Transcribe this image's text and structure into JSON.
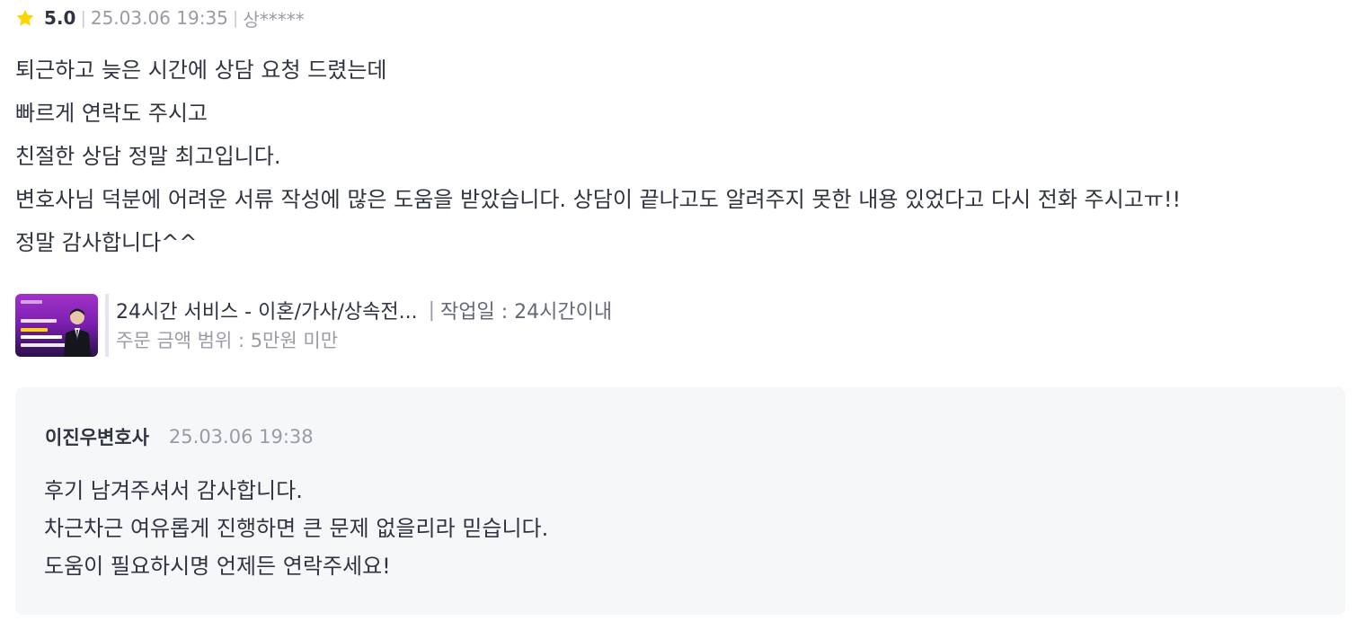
{
  "review": {
    "rating": "5.0",
    "date": "25.03.06 19:35",
    "author": "상*****",
    "separator": "|",
    "lines": [
      "퇴근하고  늦은 시간에 상담 요청 드렸는데",
      "빠르게 연락도 주시고",
      "친절한 상담 정말 최고입니다.",
      "변호사님 덕분에 어려운 서류 작성에 많은 도움을 받았습니다. 상담이 끝나고도 알려주지 못한 내용 있었다고 다시 전화 주시고ㅠ!!",
      "정말 감사합니다^^"
    ],
    "star_color": "#FFD400"
  },
  "service": {
    "title": "24시간 서비스 - 이혼/가사/상속전...",
    "separator": "|",
    "work_period": "작업일 : 24시간이내",
    "price_range": "주문 금액 범위 : 5만원 미만",
    "thumbnail_icon": "service-thumbnail-image"
  },
  "reply": {
    "author": "이진우변호사",
    "date": "25.03.06 19:38",
    "lines": [
      "후기 남겨주셔서 감사합니다.",
      "차근차근 여유롭게 진행하면 큰 문제 없을리라 믿습니다.",
      "도움이 필요하시명 언제든 연락주세요!"
    ]
  }
}
